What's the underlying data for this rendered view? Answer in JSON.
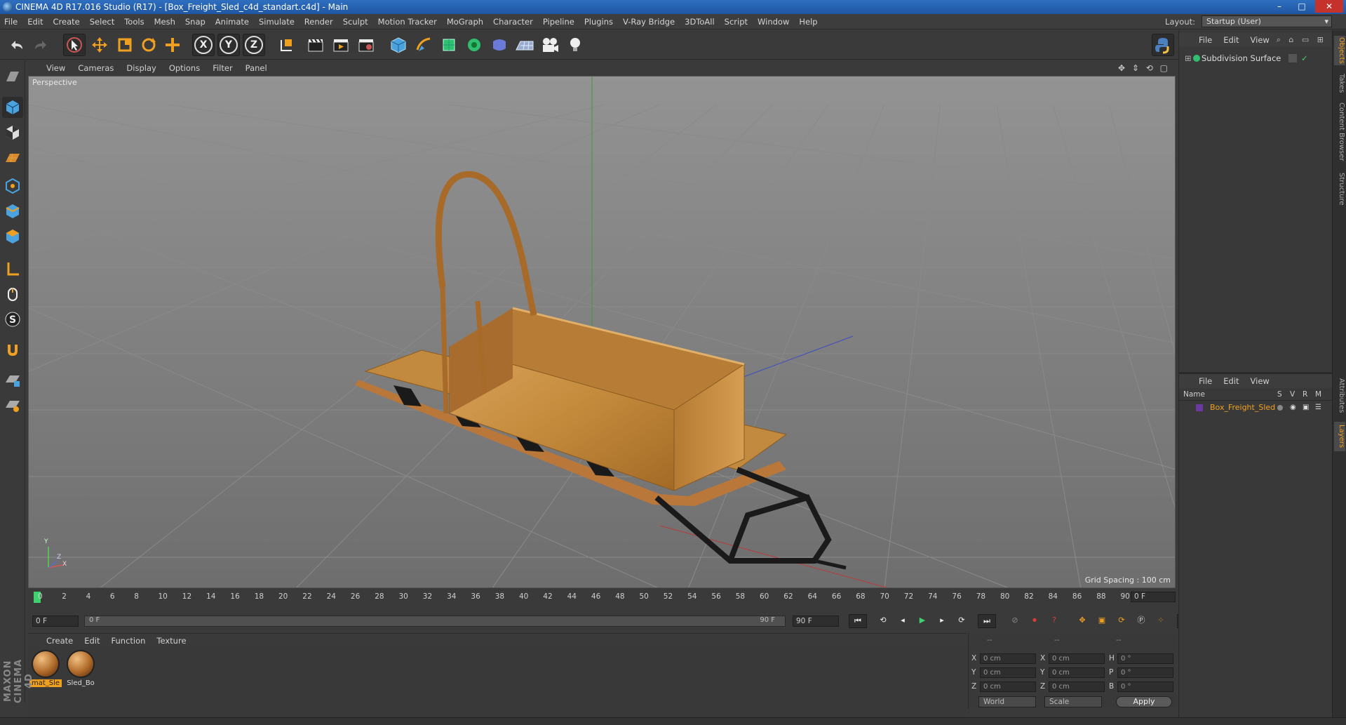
{
  "window": {
    "title": "CINEMA 4D R17.016 Studio (R17) - [Box_Freight_Sled_c4d_standart.c4d] - Main",
    "controls": [
      "–",
      "□",
      "✕"
    ]
  },
  "menubar": {
    "items": [
      "File",
      "Edit",
      "Create",
      "Select",
      "Tools",
      "Mesh",
      "Snap",
      "Animate",
      "Simulate",
      "Render",
      "Sculpt",
      "Motion Tracker",
      "MoGraph",
      "Character",
      "Pipeline",
      "Plugins",
      "V-Ray Bridge",
      "3DToAll",
      "Script",
      "Window",
      "Help"
    ],
    "layout_label": "Layout:",
    "layout_value": "Startup (User)"
  },
  "toolbar": {
    "axis_x": "X",
    "axis_y": "Y",
    "axis_z": "Z"
  },
  "viewport": {
    "menu": [
      "View",
      "Cameras",
      "Display",
      "Options",
      "Filter",
      "Panel"
    ],
    "label": "Perspective",
    "grid_spacing": "Grid Spacing : 100 cm",
    "gizmo": {
      "y": "Y",
      "x": "X",
      "z": "Z"
    }
  },
  "timeline": {
    "ticks": [
      "0",
      "2",
      "4",
      "6",
      "8",
      "10",
      "12",
      "14",
      "16",
      "18",
      "20",
      "22",
      "24",
      "26",
      "28",
      "30",
      "32",
      "34",
      "36",
      "38",
      "40",
      "42",
      "44",
      "46",
      "48",
      "50",
      "52",
      "54",
      "56",
      "58",
      "60",
      "62",
      "64",
      "66",
      "68",
      "70",
      "72",
      "74",
      "76",
      "78",
      "80",
      "82",
      "84",
      "86",
      "88",
      "90"
    ],
    "current_frame": "0 F",
    "start_field": "0 F",
    "range_start": "0 F",
    "range_end": "90 F",
    "end_field": "90 F"
  },
  "materials": {
    "menu": [
      "Create",
      "Edit",
      "Function",
      "Texture"
    ],
    "items": [
      {
        "name": "mat_Sle",
        "selected": true
      },
      {
        "name": "Sled_Bo",
        "selected": false
      }
    ]
  },
  "coordinates": {
    "header": [
      "--",
      "--",
      "--"
    ],
    "rows": [
      {
        "l1": "X",
        "v1": "0 cm",
        "l2": "X",
        "v2": "0 cm",
        "l3": "H",
        "v3": "0 °"
      },
      {
        "l1": "Y",
        "v1": "0 cm",
        "l2": "Y",
        "v2": "0 cm",
        "l3": "P",
        "v3": "0 °"
      },
      {
        "l1": "Z",
        "v1": "0 cm",
        "l2": "Z",
        "v2": "0 cm",
        "l3": "B",
        "v3": "0 °"
      }
    ],
    "mode": "World",
    "scale": "Scale",
    "apply": "Apply"
  },
  "objects_panel": {
    "menu": [
      "File",
      "Edit",
      "View"
    ],
    "object": "Subdivision Surface"
  },
  "layers_panel": {
    "menu": [
      "File",
      "Edit",
      "View"
    ],
    "columns": [
      "Name",
      "S",
      "V",
      "R",
      "M"
    ],
    "layer": "Box_Freight_Sled"
  },
  "side_tabs": [
    "Objects",
    "Takes",
    "Content Browser",
    "Structure",
    "Attributes",
    "Layers"
  ],
  "branding": "MAXON CINEMA 4D",
  "colors": {
    "accent": "#f0a020",
    "viewport_bg": "#7a7a7a",
    "wood": "#c98a3a"
  }
}
